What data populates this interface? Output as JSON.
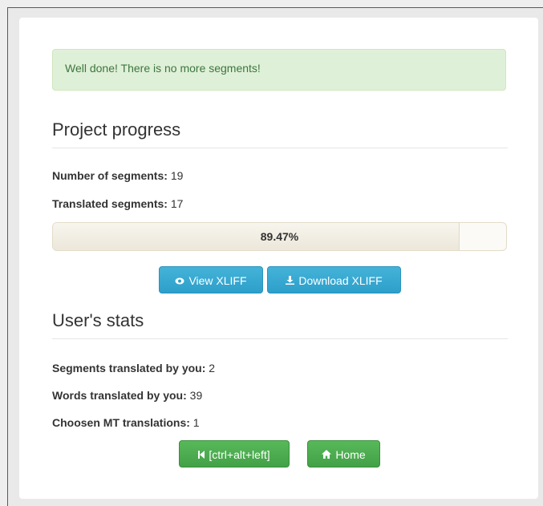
{
  "alert": {
    "message": "Well done! There is no more segments!"
  },
  "project_progress": {
    "title": "Project progress",
    "segments_label": "Number of segments:",
    "segments_value": "19",
    "translated_label": "Translated segments:",
    "translated_value": "17",
    "progress_text": "89.47%",
    "progress_fraction": 0.8947
  },
  "buttons": {
    "view_xliff": "View XLIFF",
    "view_icon": "eye-icon",
    "download_xliff": "Download XLIFF",
    "download_icon": "download-icon",
    "prev": "[ctrl+alt+left]",
    "prev_icon": "step-backward-icon",
    "home": "Home",
    "home_icon": "home-icon"
  },
  "user_stats": {
    "title": "User's stats",
    "segments_label": "Segments translated by you:",
    "segments_value": "2",
    "words_label": "Words translated by you:",
    "words_value": "39",
    "mt_label": "Choosen MT translations:",
    "mt_value": "1"
  },
  "colors": {
    "alert_bg": "#dff0d8",
    "alert_text": "#3c763d",
    "info_button": "#31a8d4",
    "success_button": "#4cae4f"
  }
}
